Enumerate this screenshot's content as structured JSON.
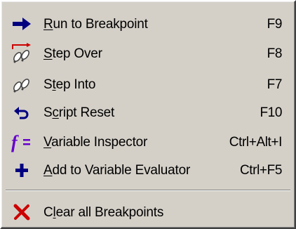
{
  "menu": {
    "items": [
      {
        "key": "R",
        "rest": "un to Breakpoint",
        "shortcut": "F9",
        "icon": "arrow-right-icon"
      },
      {
        "key": "S",
        "rest": "tep Over",
        "shortcut": "F8",
        "icon": "step-over-footprints-icon"
      },
      {
        "pre": "S",
        "key": "t",
        "rest": "ep Into",
        "shortcut": "F7",
        "icon": "step-into-footprints-icon"
      },
      {
        "pre": "S",
        "key": "c",
        "rest": "ript Reset",
        "shortcut": "F10",
        "icon": "undo-arrow-icon"
      },
      {
        "key": "V",
        "rest": "ariable Inspector",
        "shortcut": "Ctrl+Alt+I",
        "icon": "function-icon"
      },
      {
        "key": "A",
        "rest": "dd to Variable Evaluator",
        "shortcut": "Ctrl+F5",
        "icon": "plus-icon"
      },
      {
        "pre": "C",
        "key": "l",
        "rest": "ear all Breakpoints",
        "shortcut": "",
        "icon": "red-x-icon"
      }
    ]
  },
  "colors": {
    "menu_background": "#d4d0c8",
    "icon_blue": "#000080",
    "function_purple": "#6600cc",
    "clear_red": "#cc0000"
  }
}
